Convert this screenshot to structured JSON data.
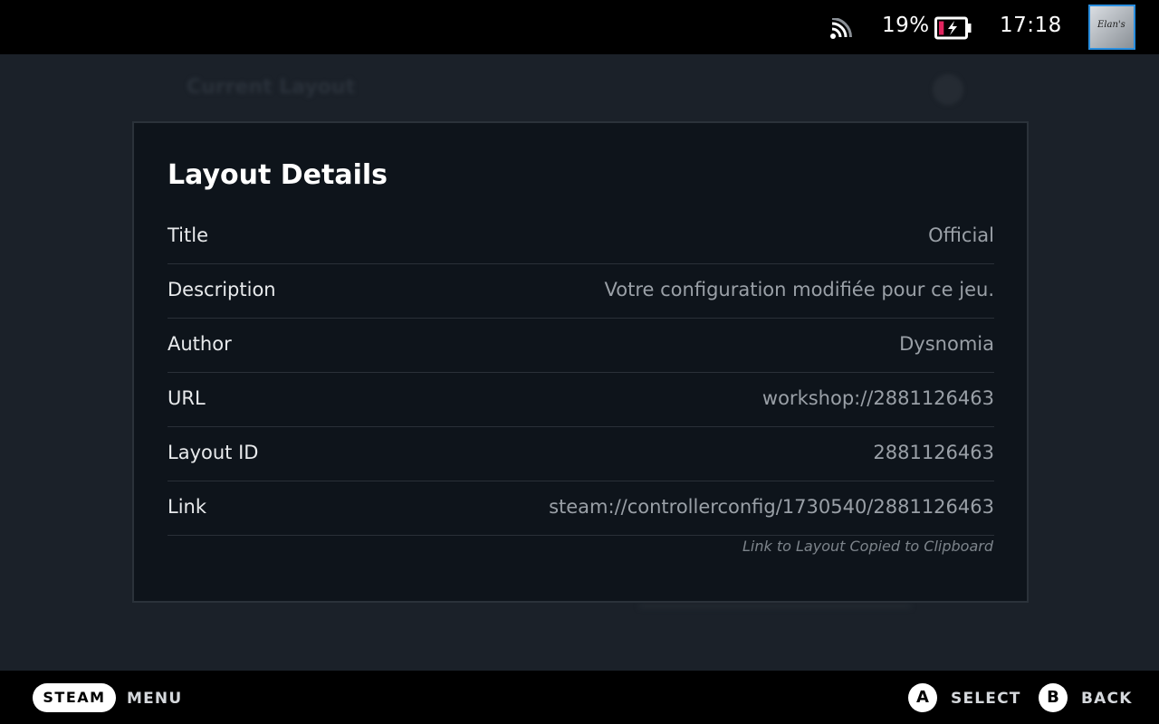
{
  "status_bar": {
    "battery_percent": "19%",
    "battery_level": 0.19,
    "time": "17:18",
    "avatar_text": "Elan's",
    "battery_color": "#e0245e"
  },
  "modal": {
    "title": "Layout Details",
    "rows": [
      {
        "label": "Title",
        "value": "Official"
      },
      {
        "label": "Description",
        "value": "Votre configuration modifiée pour ce jeu."
      },
      {
        "label": "Author",
        "value": "Dysnomia"
      },
      {
        "label": "URL",
        "value": "workshop://2881126463"
      },
      {
        "label": "Layout ID",
        "value": "2881126463"
      },
      {
        "label": "Link",
        "value": "steam://controllerconfig/1730540/2881126463"
      }
    ],
    "clipboard_note": "Link to Layout Copied to Clipboard"
  },
  "background": {
    "section_title": "Current Layout"
  },
  "bottom_bar": {
    "steam_label": "STEAM",
    "menu_label": "MENU",
    "a_button": "A",
    "select_label": "SELECT",
    "b_button": "B",
    "back_label": "BACK"
  }
}
